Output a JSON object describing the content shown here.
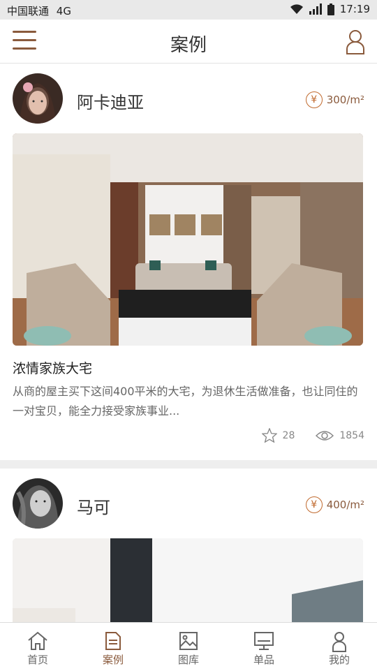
{
  "status_bar": {
    "carrier": "中国联通",
    "network": "4G",
    "time": "17:19"
  },
  "header": {
    "title": "案例"
  },
  "cards": [
    {
      "author": "阿卡迪亚",
      "price": "300/m²",
      "title": "浓情家族大宅",
      "desc": "从商的屋主买下这间400平米的大宅，为退休生活做准备，也让同住的一对宝贝，能全力接受家族事业...",
      "favorites": "28",
      "views": "1854"
    },
    {
      "author": "马可",
      "price": "400/m²"
    }
  ],
  "tabbar": {
    "tabs": [
      {
        "label": "首页",
        "icon": "home-icon"
      },
      {
        "label": "案例",
        "icon": "document-icon"
      },
      {
        "label": "图库",
        "icon": "image-icon"
      },
      {
        "label": "单品",
        "icon": "monitor-icon"
      },
      {
        "label": "我的",
        "icon": "user-icon"
      }
    ],
    "active_index": 1
  },
  "colors": {
    "accent": "#8a5a3c",
    "price": "#c0692d",
    "background": "#eeeeee"
  }
}
